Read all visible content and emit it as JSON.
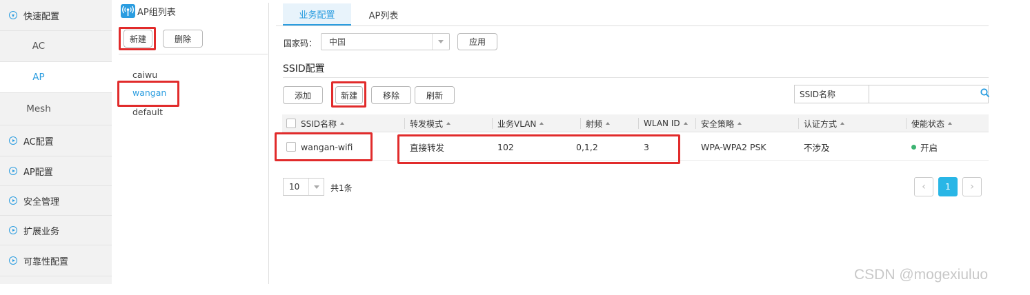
{
  "nav": {
    "quick_config": "快速配置",
    "sub_items": [
      "AC",
      "AP",
      "Mesh"
    ],
    "active_sub": "AP",
    "sections": [
      "AC配置",
      "AP配置",
      "安全管理",
      "扩展业务",
      "可靠性配置"
    ]
  },
  "ap_group": {
    "title": "AP组列表",
    "new_label": "新建",
    "delete_label": "删除",
    "groups": [
      "caiwu",
      "wangan",
      "default"
    ],
    "selected_group": "wangan"
  },
  "tabs": {
    "service_config": "业务配置",
    "ap_list": "AP列表"
  },
  "country": {
    "label": "国家码：",
    "value": "中国",
    "apply_label": "应用"
  },
  "ssid_config": {
    "title": "SSID配置",
    "buttons": {
      "add": "添加",
      "new": "新建",
      "remove": "移除",
      "refresh": "刷新"
    },
    "search_label": "SSID名称",
    "search_value": ""
  },
  "table": {
    "columns": [
      "SSID名称",
      "转发模式",
      "业务VLAN",
      "射频",
      "WLAN ID",
      "安全策略",
      "认证方式",
      "使能状态"
    ],
    "rows": [
      {
        "ssid": "wangan-wifi",
        "forward_mode": "直接转发",
        "vlan": "102",
        "radio": "0,1,2",
        "wlan_id": "3",
        "security": "WPA-WPA2 PSK",
        "auth": "不涉及",
        "status": "开启"
      }
    ],
    "status_color": "#3cb371"
  },
  "pager": {
    "page_size": "10",
    "total": "共1条",
    "current_page": "1"
  },
  "colors": {
    "accent": "#2b9de0",
    "highlight": "#e12b2b",
    "page_active": "#29b6e6"
  },
  "watermark": "CSDN @mogexiuluo"
}
